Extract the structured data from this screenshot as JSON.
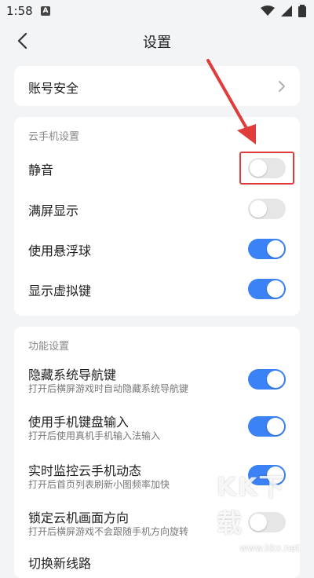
{
  "status_bar": {
    "time": "1:58",
    "badge": "A"
  },
  "header": {
    "title": "设置"
  },
  "account": {
    "label": "账号安全"
  },
  "cloud_phone": {
    "section_title": "云手机设置",
    "items": [
      {
        "label": "静音",
        "state": "off"
      },
      {
        "label": "满屏显示",
        "state": "off"
      },
      {
        "label": "使用悬浮球",
        "state": "on"
      },
      {
        "label": "显示虚拟键",
        "state": "on"
      }
    ]
  },
  "features": {
    "section_title": "功能设置",
    "items": [
      {
        "label": "隐藏系统导航键",
        "sub": "打开后横屏游戏时自动隐藏系统导航键",
        "state": "on"
      },
      {
        "label": "使用手机键盘输入",
        "sub": "打开后使用真机手机输入法输入",
        "state": "on"
      },
      {
        "label": "实时监控云手机动态",
        "sub": "打开后首页列表刷新小图频率加快",
        "state": "on"
      },
      {
        "label": "锁定云机画面方向",
        "sub": "打开后横屏游戏不会跟随手机方向旋转",
        "state": "off"
      },
      {
        "label": "切换新线路"
      }
    ]
  },
  "watermark": {
    "text": "KK下载",
    "url": "www.kkx.net"
  },
  "colors": {
    "accent": "#3b82f6",
    "annotation": "#e03c3c",
    "background": "#f3f4f6"
  }
}
